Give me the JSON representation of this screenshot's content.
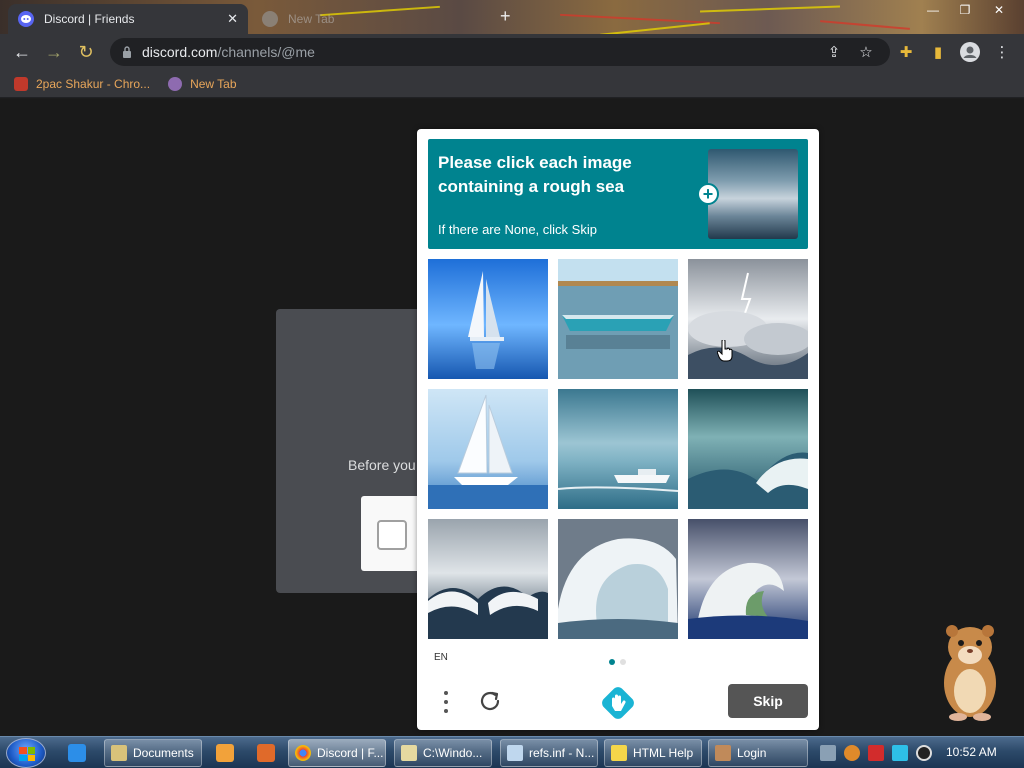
{
  "browser": {
    "tabs": [
      {
        "title": "Discord | Friends",
        "active": true
      },
      {
        "title": "New Tab",
        "active": false
      }
    ],
    "url_host": "discord.com",
    "url_path": "/channels/@me",
    "bookmarks": [
      {
        "label": "2pac Shakur - Chro..."
      },
      {
        "label": "New Tab"
      }
    ]
  },
  "page": {
    "background_text": "Before you"
  },
  "captcha": {
    "title": "Please click each image containing a rough sea",
    "subtitle": "If there are None, click Skip",
    "language": "EN",
    "skip_label": "Skip",
    "accent_color": "#00838f",
    "grid": [
      {
        "kind": "sailboat-calm"
      },
      {
        "kind": "rowboat-calm"
      },
      {
        "kind": "storm-lightning"
      },
      {
        "kind": "sailboat-calm"
      },
      {
        "kind": "cruise-ship-calm"
      },
      {
        "kind": "rough-wave"
      },
      {
        "kind": "rough-sea"
      },
      {
        "kind": "big-wave"
      },
      {
        "kind": "big-wave"
      }
    ]
  },
  "taskbar": {
    "tasks": [
      {
        "label": "Documents"
      },
      {
        "label": "Discord | F..."
      },
      {
        "label": "C:\\Windo..."
      },
      {
        "label": "refs.inf - N..."
      },
      {
        "label": "HTML Help"
      },
      {
        "label": "Login"
      }
    ],
    "clock": "10:52 AM"
  }
}
